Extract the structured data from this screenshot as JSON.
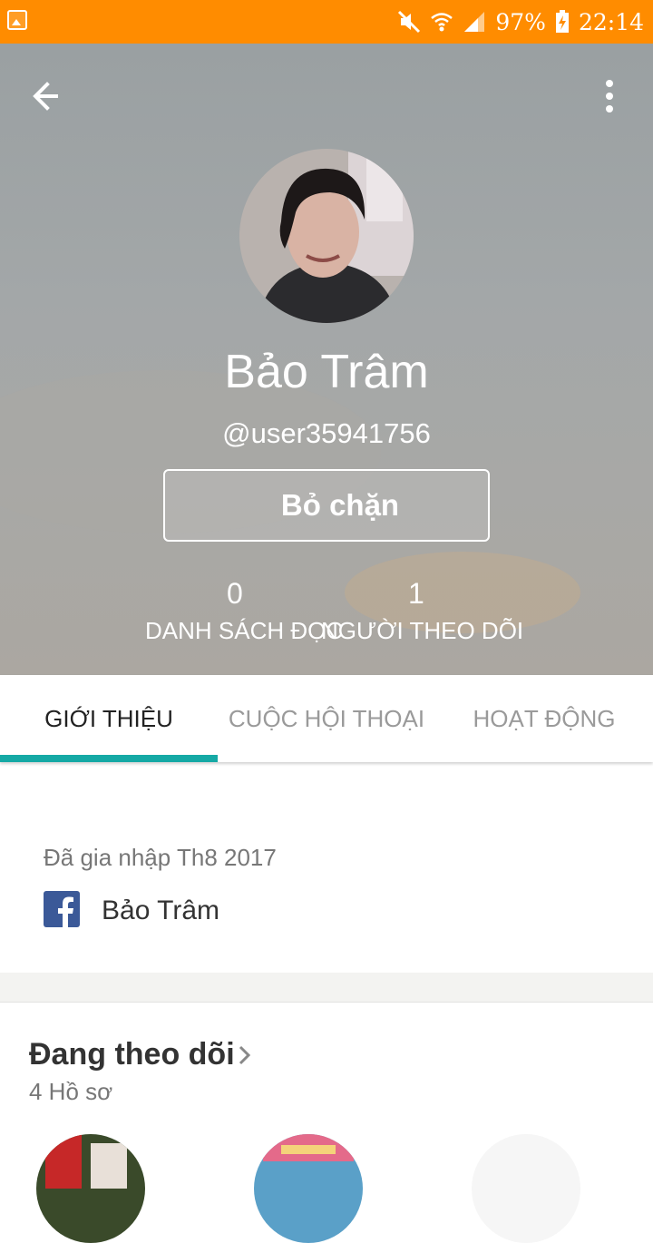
{
  "status_bar": {
    "battery": "97%",
    "time": "22:14",
    "icons": [
      "gallery-icon",
      "mute-icon",
      "wifi-icon",
      "signal-icon",
      "battery-charging-icon"
    ]
  },
  "header": {
    "profile_name": "Bảo Trâm",
    "username": "@user35941756",
    "unblock_label": "Bỏ chặn",
    "stats": {
      "reading_lists_count": "0",
      "reading_lists_label": "DANH SÁCH ĐỌC",
      "followers_count": "1",
      "followers_label": "NGƯỜI THEO DÕI"
    }
  },
  "tabs": [
    {
      "label": "GIỚI THIỆU",
      "active": true
    },
    {
      "label": "CUỘC HỘI THOẠI",
      "active": false
    },
    {
      "label": "HOẠT ĐỘNG",
      "active": false
    }
  ],
  "about": {
    "joined": "Đã gia nhập Th8 2017",
    "facebook_name": "Bảo Trâm"
  },
  "following": {
    "title": "Đang theo dõi",
    "count": "4 Hồ sơ"
  },
  "colors": {
    "status_bar": "#ff8c00",
    "tab_indicator": "#15a9a5",
    "facebook": "#3b5998"
  }
}
